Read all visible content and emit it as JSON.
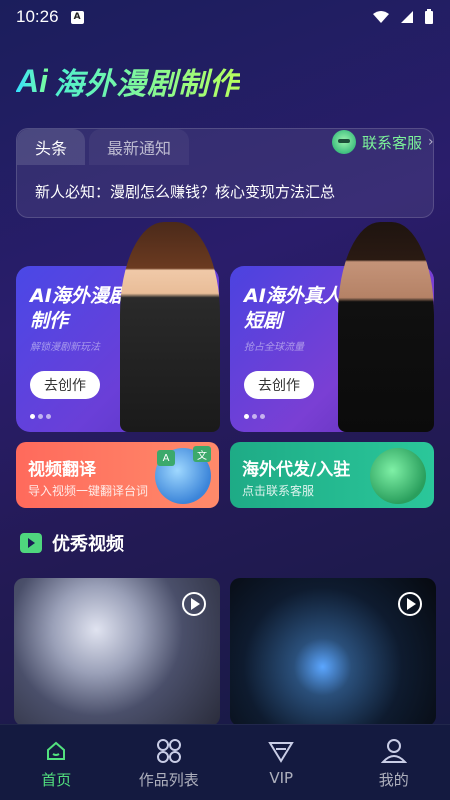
{
  "status_bar": {
    "time": "10:26",
    "app_icon_letter": "A"
  },
  "header": {
    "ai_logo": "Ai",
    "title": "海外漫剧制作"
  },
  "notice": {
    "tabs": [
      {
        "label": "头条",
        "active": true
      },
      {
        "label": "最新通知",
        "active": false
      }
    ],
    "support_label": "联系客服",
    "headline": "新人必知：漫剧怎么赚钱？核心变现方法汇总"
  },
  "features": [
    {
      "title": "AI海外漫剧制作",
      "subtitle": "解锁漫剧新玩法",
      "button": "去创作"
    },
    {
      "title": "AI海外真人短剧",
      "subtitle": "抢占全球流量",
      "button": "去创作"
    }
  ],
  "services": [
    {
      "title": "视频翻译",
      "subtitle": "导入视频一键翻译台词",
      "color": "#ff7462",
      "badges": [
        "A",
        "文"
      ]
    },
    {
      "title": "海外代发/入驻",
      "subtitle": "点击联系客服",
      "color": "#22b58d"
    }
  ],
  "section": {
    "title": "优秀视频"
  },
  "bottom_nav": [
    {
      "label": "首页",
      "icon": "home-icon",
      "active": true
    },
    {
      "label": "作品列表",
      "icon": "grid-icon",
      "active": false
    },
    {
      "label": "VIP",
      "icon": "diamond-icon",
      "active": false
    },
    {
      "label": "我的",
      "icon": "person-icon",
      "active": false
    }
  ],
  "colors": {
    "accent": "#52e07e",
    "support": "#7cf29a"
  }
}
